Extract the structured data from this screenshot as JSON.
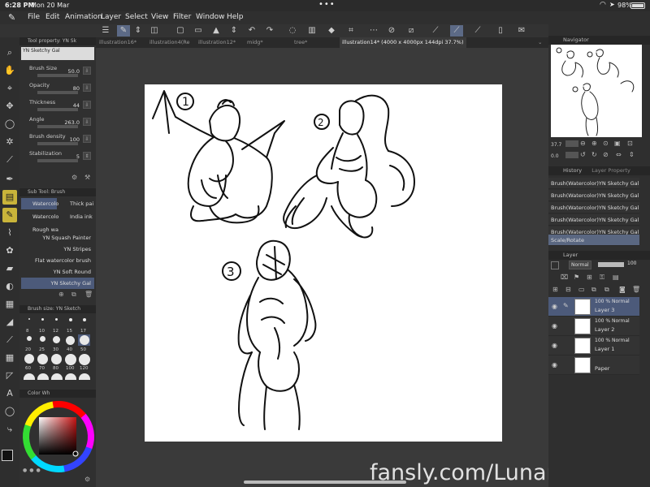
{
  "status": {
    "time": "6:28 PM",
    "date": "Mon 20 Mar",
    "battery": "98%"
  },
  "menu": [
    "File",
    "Edit",
    "Animation",
    "Layer",
    "Select",
    "View",
    "Filter",
    "Window",
    "Help"
  ],
  "tabs": [
    "illustration16*",
    "illustration4(Re",
    "illustration12*",
    "midg*",
    "tree*",
    "illustration14* (4000 x 4000px 144dpi 37.7%)"
  ],
  "tool_property": {
    "header": "Tool property: YN Sk",
    "brush_name": "YN Sketchy Gal",
    "props": [
      {
        "label": "Brush Size",
        "value": "50.0"
      },
      {
        "label": "Opacity",
        "value": "80"
      },
      {
        "label": "Thickness",
        "value": "44"
      },
      {
        "label": "Angle",
        "value": "263.0"
      },
      {
        "label": "Brush density",
        "value": "100"
      },
      {
        "label": "Stabilization",
        "value": "5"
      }
    ]
  },
  "sub_tool": {
    "header": "Sub Tool: Brush",
    "items_row": [
      [
        "Watercolo",
        "Thick pai"
      ],
      [
        "Watercolo",
        "India ink"
      ],
      [
        "Rough wa",
        ""
      ]
    ],
    "list": [
      "YN Squash Painter",
      "YN Stripes",
      "Flat watercolor brush",
      "YN Soft Round",
      "YN Sketchy Gal"
    ]
  },
  "brush_size": {
    "header": "Brush size: YN Sketch",
    "sizes": [
      "8",
      "10",
      "12",
      "15",
      "17",
      "20",
      "25",
      "30",
      "40",
      "50",
      "60",
      "70",
      "80",
      "100",
      "120"
    ]
  },
  "color_wheel": {
    "header": "Color Wh"
  },
  "navigator": {
    "header": "Navigator",
    "zoom": "37.7",
    "angle": "0.0"
  },
  "history": {
    "tabs": [
      "History",
      "Layer Property"
    ],
    "items": [
      "Brush(Watercolor)YN Sketchy Gal",
      "Brush(Watercolor)YN Sketchy Gal",
      "Brush(Watercolor)YN Sketchy Gal",
      "Brush(Watercolor)YN Sketchy Gal",
      "Brush(Watercolor)YN Sketchy Gal",
      "Scale/Rotate"
    ]
  },
  "layer": {
    "header": "Layer",
    "blend": "Normal",
    "opacity": "100",
    "rows": [
      {
        "pct": "100 % Normal",
        "name": "Layer 3"
      },
      {
        "pct": "100 % Normal",
        "name": "Layer 2"
      },
      {
        "pct": "100 % Normal",
        "name": "Layer 1"
      },
      {
        "pct": "",
        "name": "Paper"
      }
    ]
  },
  "sketch_labels": [
    "1",
    "2",
    "3"
  ],
  "watermark": "fansly.com/LunariDonna",
  "colors": {
    "accent": "#5c6a86",
    "tool_active": "#c9b43a",
    "bg": "#3a3a3a"
  }
}
